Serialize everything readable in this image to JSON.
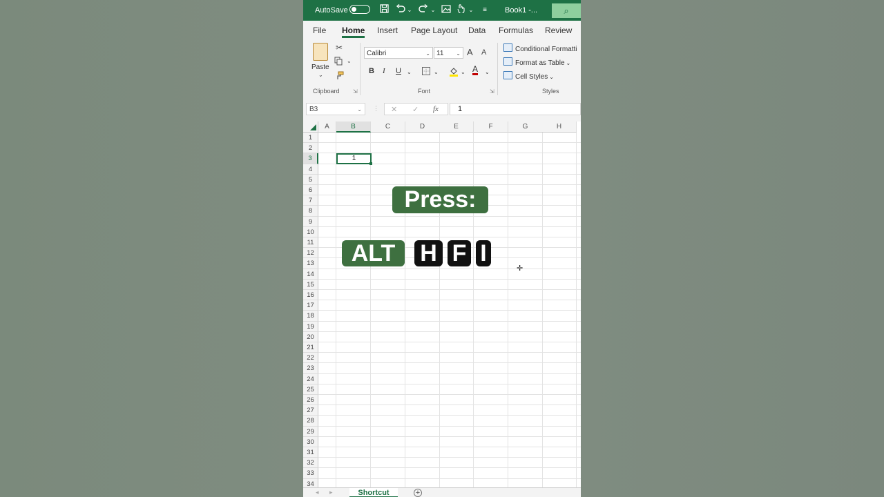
{
  "titlebar": {
    "autosave_label": "AutoSave",
    "book_title": "Book1 -...",
    "search_icon": "⌕"
  },
  "tabs": [
    "File",
    "Home",
    "Insert",
    "Page Layout",
    "Data",
    "Formulas",
    "Review"
  ],
  "ribbon": {
    "clipboard": {
      "paste_label": "Paste",
      "group_label": "Clipboard"
    },
    "font": {
      "font_name": "Calibri",
      "font_size": "11",
      "grow_label": "A",
      "shrink_label": "A",
      "bold": "B",
      "italic": "I",
      "underline": "U",
      "font_color_label": "A",
      "group_label": "Font"
    },
    "styles": {
      "conditional_formatting": "Conditional Formatti",
      "format_as_table": "Format as Table",
      "cell_styles": "Cell Styles",
      "group_label": "Styles"
    }
  },
  "formula_bar": {
    "name_box": "B3",
    "cancel_icon": "✕",
    "enter_icon": "✓",
    "fx_label": "fx",
    "formula_value": "1"
  },
  "grid": {
    "columns": [
      "A",
      "B",
      "C",
      "D",
      "E",
      "F",
      "G",
      "H"
    ],
    "selected_column": "B",
    "selected_row": "3",
    "rows": [
      "1",
      "2",
      "3",
      "4",
      "5",
      "6",
      "7",
      "8",
      "9",
      "10",
      "11",
      "12",
      "13",
      "14",
      "15",
      "16",
      "17",
      "18",
      "19",
      "20",
      "21",
      "22",
      "23",
      "24",
      "25",
      "26",
      "27",
      "28",
      "29",
      "30",
      "31",
      "32",
      "33",
      "34"
    ],
    "active_cell_value": "1"
  },
  "overlay": {
    "press_label": "Press:",
    "keys": [
      "ALT",
      "H",
      "F",
      "I"
    ]
  },
  "sheets": {
    "active_sheet": "Shortcut",
    "add_sheet_icon": "+"
  },
  "colors": {
    "excel_green": "#1e7145",
    "key_green": "#3e7040",
    "key_dark": "#111111"
  }
}
